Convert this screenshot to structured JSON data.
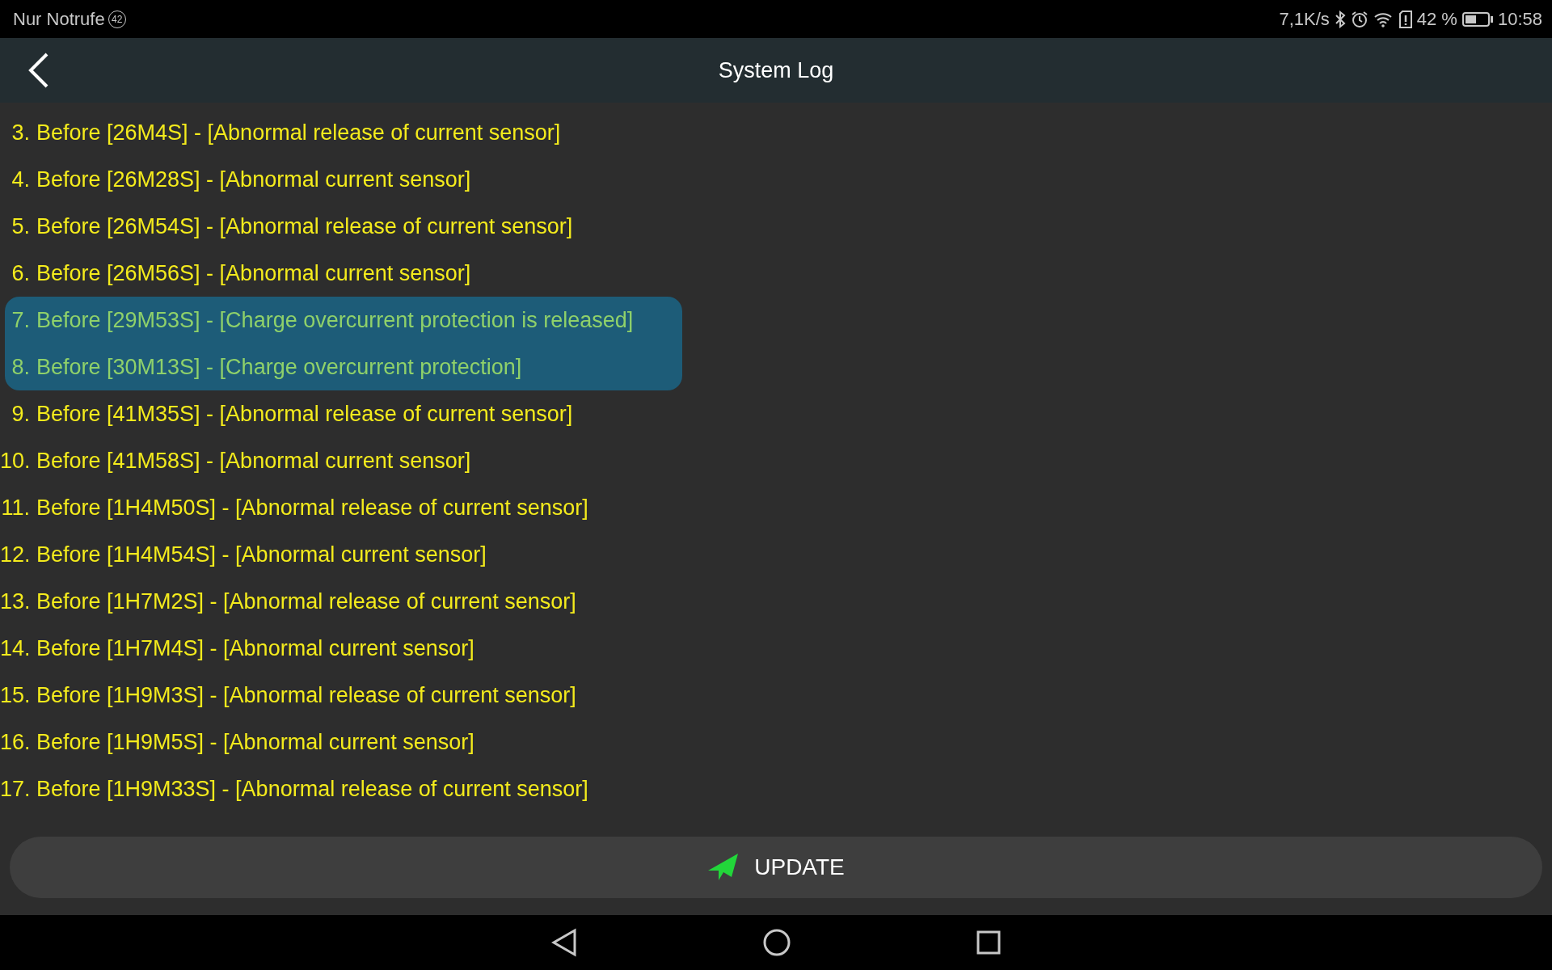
{
  "status_bar": {
    "carrier": "Nur Notrufe",
    "notification_count": "42",
    "net_speed": "7,1K/s",
    "battery_percent": "42 %",
    "time": "10:58"
  },
  "header": {
    "title": "System Log"
  },
  "log": [
    {
      "index": "3.",
      "text": "Before [26M4S] - [Abnormal release of current sensor]",
      "selected": false
    },
    {
      "index": "4.",
      "text": "Before [26M28S] - [Abnormal current sensor]",
      "selected": false
    },
    {
      "index": "5.",
      "text": "Before [26M54S] - [Abnormal release of current sensor]",
      "selected": false
    },
    {
      "index": "6.",
      "text": "Before [26M56S] - [Abnormal current sensor]",
      "selected": false
    },
    {
      "index": "7.",
      "text": "Before [29M53S] - [Charge overcurrent protection is released]",
      "selected": true
    },
    {
      "index": "8.",
      "text": "Before [30M13S] - [Charge overcurrent protection]",
      "selected": true
    },
    {
      "index": "9.",
      "text": "Before [41M35S] - [Abnormal release of current sensor]",
      "selected": false
    },
    {
      "index": "10.",
      "text": "Before [41M58S] - [Abnormal current sensor]",
      "selected": false
    },
    {
      "index": "11.",
      "text": "Before [1H4M50S] - [Abnormal release of current sensor]",
      "selected": false
    },
    {
      "index": "12.",
      "text": "Before [1H4M54S] - [Abnormal current sensor]",
      "selected": false
    },
    {
      "index": "13.",
      "text": "Before [1H7M2S] - [Abnormal release of current sensor]",
      "selected": false
    },
    {
      "index": "14.",
      "text": "Before [1H7M4S] - [Abnormal current sensor]",
      "selected": false
    },
    {
      "index": "15.",
      "text": "Before [1H9M3S] - [Abnormal release of current sensor]",
      "selected": false
    },
    {
      "index": "16.",
      "text": "Before [1H9M5S] - [Abnormal current sensor]",
      "selected": false
    },
    {
      "index": "17.",
      "text": "Before [1H9M33S] - [Abnormal release of current sensor]",
      "selected": false
    }
  ],
  "update_button": {
    "label": "UPDATE"
  }
}
